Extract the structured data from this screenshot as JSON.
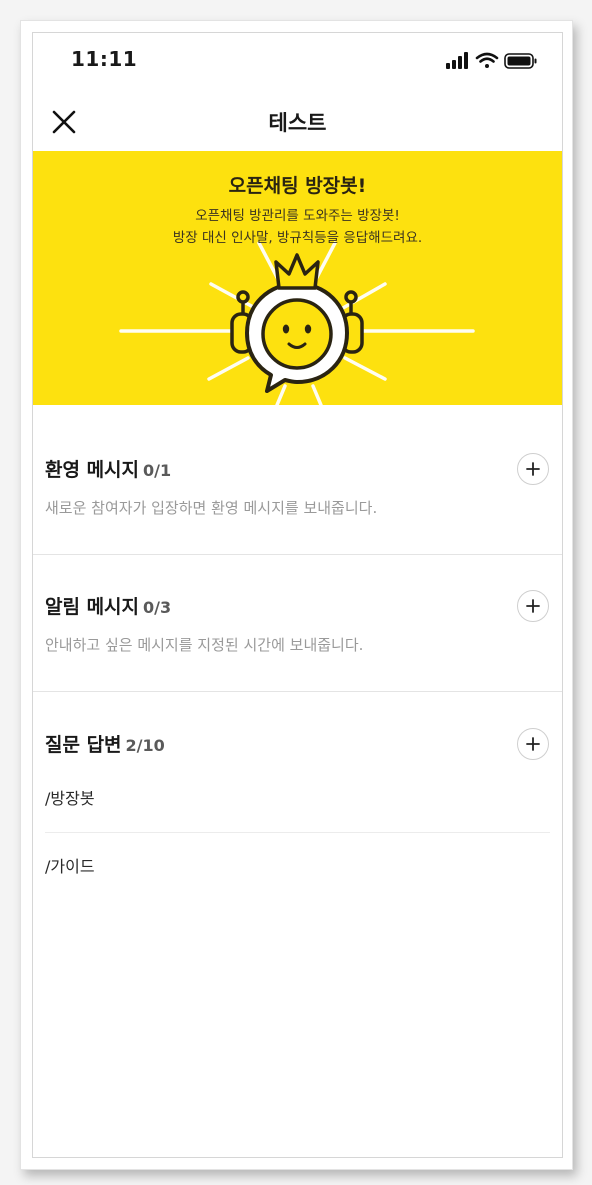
{
  "status_bar": {
    "time": "11:11",
    "icons": [
      "cellular-signal-icon",
      "wifi-icon",
      "battery-icon"
    ]
  },
  "header": {
    "title": "테스트",
    "close_icon": "close-icon"
  },
  "banner": {
    "title": "오픈채팅 방장봇!",
    "description_lines": [
      "오픈채팅 방관리를 도와주는 방장봇!",
      "방장 대신 인사말, 방규칙등을 응답해드려요."
    ],
    "background_color": "#fde10f",
    "illustration": "bot-mascot-icon"
  },
  "sections": {
    "welcome": {
      "title": "환영 메시지",
      "count": "0/1",
      "description": "새로운 참여자가 입장하면 환영 메시지를 보내줍니다.",
      "add_icon": "plus-icon"
    },
    "notice": {
      "title": "알림 메시지",
      "count": "0/3",
      "description": "안내하고 싶은 메시지를 지정된 시간에 보내줍니다.",
      "add_icon": "plus-icon"
    },
    "qa": {
      "title": "질문 답변",
      "count": "2/10",
      "items": [
        "/방장봇",
        "/가이드"
      ],
      "add_icon": "plus-icon"
    }
  }
}
